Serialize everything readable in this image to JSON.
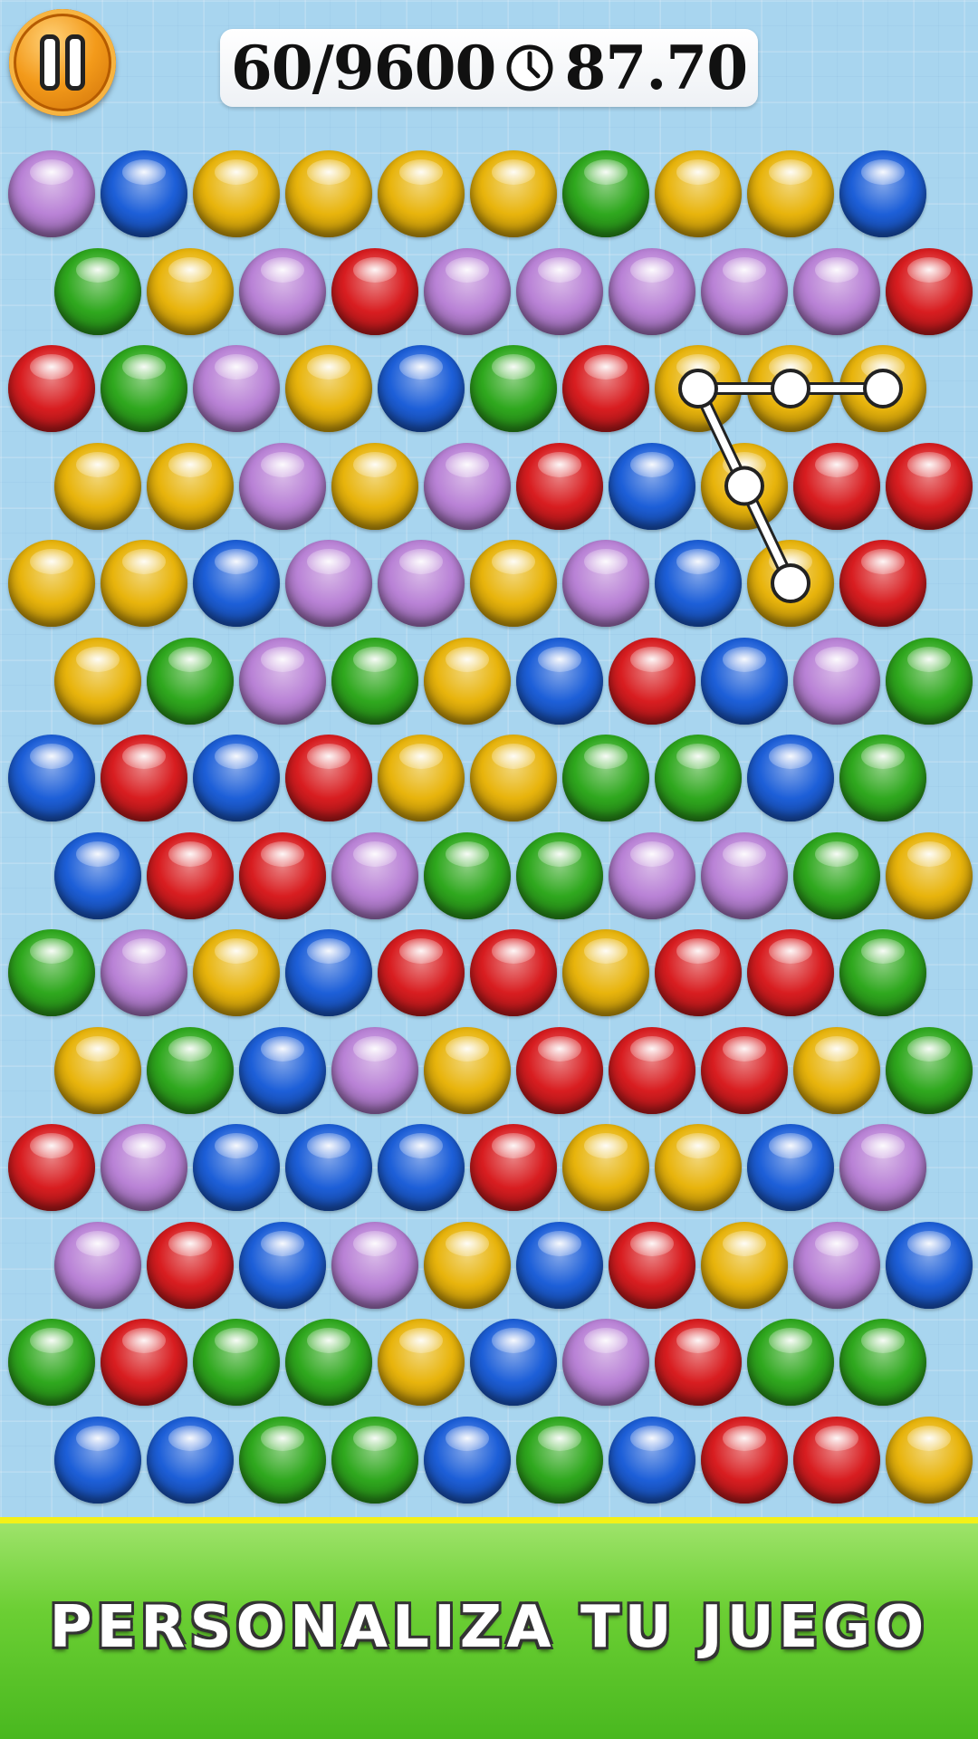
{
  "hud": {
    "score": "60/9600",
    "timer": "87.70"
  },
  "icons": {
    "pause": "pause-icon",
    "clock": "clock-icon"
  },
  "colors": {
    "purple": "#b982d6",
    "blue": "#1d5fd8",
    "yellow": "#e8b40c",
    "green": "#2fa81e",
    "red": "#d81d20",
    "chain": "#ffffff"
  },
  "grid": {
    "rows": [
      [
        "purple",
        "blue",
        "yellow",
        "yellow",
        "yellow",
        "yellow",
        "green",
        "yellow",
        "yellow",
        "blue"
      ],
      [
        "green",
        "yellow",
        "purple",
        "red",
        "purple",
        "purple",
        "purple",
        "purple",
        "purple",
        "red"
      ],
      [
        "red",
        "green",
        "purple",
        "yellow",
        "blue",
        "green",
        "red",
        "yellow",
        "yellow",
        "yellow"
      ],
      [
        "yellow",
        "yellow",
        "purple",
        "yellow",
        "purple",
        "red",
        "blue",
        "yellow",
        "red",
        "red"
      ],
      [
        "yellow",
        "yellow",
        "blue",
        "purple",
        "purple",
        "yellow",
        "purple",
        "blue",
        "yellow",
        "red"
      ],
      [
        "yellow",
        "green",
        "purple",
        "green",
        "yellow",
        "blue",
        "red",
        "blue",
        "purple",
        "green"
      ],
      [
        "blue",
        "red",
        "blue",
        "red",
        "yellow",
        "yellow",
        "green",
        "green",
        "blue",
        "green"
      ],
      [
        "blue",
        "red",
        "red",
        "purple",
        "green",
        "green",
        "purple",
        "purple",
        "green",
        "yellow"
      ],
      [
        "green",
        "purple",
        "yellow",
        "blue",
        "red",
        "red",
        "yellow",
        "red",
        "red",
        "green"
      ],
      [
        "yellow",
        "green",
        "blue",
        "purple",
        "yellow",
        "red",
        "red",
        "red",
        "yellow",
        "green"
      ],
      [
        "red",
        "purple",
        "blue",
        "blue",
        "blue",
        "red",
        "yellow",
        "yellow",
        "blue",
        "purple"
      ],
      [
        "purple",
        "red",
        "blue",
        "purple",
        "yellow",
        "blue",
        "red",
        "yellow",
        "purple",
        "blue"
      ],
      [
        "green",
        "red",
        "green",
        "green",
        "yellow",
        "blue",
        "purple",
        "red",
        "green",
        "green"
      ],
      [
        "blue",
        "blue",
        "green",
        "green",
        "blue",
        "green",
        "blue",
        "red",
        "red",
        "yellow"
      ]
    ]
  },
  "selection_chain": [
    [
      2,
      9
    ],
    [
      2,
      8
    ],
    [
      2,
      7
    ],
    [
      3,
      7
    ],
    [
      4,
      8
    ]
  ],
  "banner": {
    "text": "PERSONALIZA TU JUEGO"
  }
}
